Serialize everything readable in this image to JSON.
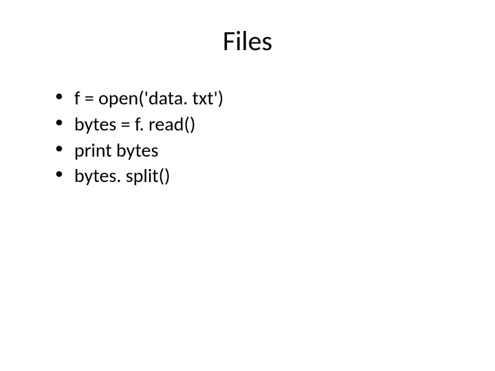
{
  "slide": {
    "title": "Files",
    "bullets": [
      "f = open('data. txt')",
      "bytes = f. read()",
      "print bytes",
      "bytes. split()"
    ]
  }
}
